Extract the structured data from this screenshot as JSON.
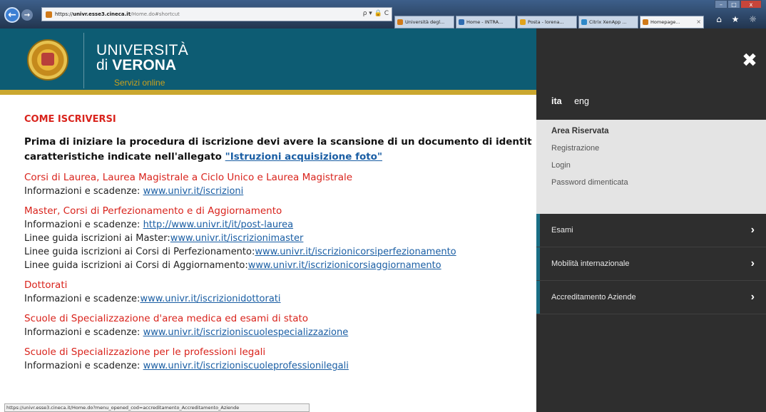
{
  "browser": {
    "url_scheme": "https://",
    "url_domain": "univr.esse3.cineca.it",
    "url_path": "/Home.do#shortcut",
    "url_display": "https://univr.esse3.cineca.it/Home.do#shortcut",
    "address_icons": "ρ ▾ 🔒 C",
    "tabs": [
      {
        "label": "Università degl...",
        "icon_color": "#d07a19",
        "active": false
      },
      {
        "label": "Home - INTRA...",
        "icon_color": "#2f6cb0",
        "active": false
      },
      {
        "label": "Posta - lorena...",
        "icon_color": "#e0a21a",
        "active": false
      },
      {
        "label": "Citrix XenApp ...",
        "icon_color": "#2e88c8",
        "active": false
      },
      {
        "label": "Homepage...",
        "icon_color": "#d07a19",
        "active": true
      }
    ],
    "tab_close": "×",
    "toolbar_icons": "⌂ ★ ☼",
    "win_min": "–",
    "win_max": "□",
    "win_close": "x",
    "status_url": "https://univr.esse3.cineca.it/Home.do?menu_opened_cod=accreditamento_Accreditamento_Aziende"
  },
  "header": {
    "uni_line1": "UNIVERSITÀ",
    "uni_line2_prefix": "di ",
    "uni_line2_bold": "VERONA",
    "servizi": "Servizi online"
  },
  "content": {
    "section_title": "COME ISCRIVERSI",
    "intro_line1": "Prima di iniziare la procedura di iscrizione devi avere la scansione di un documento di identit",
    "intro_line2_text": "caratteristiche indicate nell'allegato ",
    "intro_line2_link": "\"Istruzioni acquisizione foto\"",
    "blocks": [
      {
        "title": "Corsi di Laurea, Laurea Magistrale a Ciclo Unico e Laurea Magistrale",
        "lines": [
          {
            "text": "Informazioni e scadenze: ",
            "link": "www.univr.it/iscrizioni"
          }
        ]
      },
      {
        "title": "Master, Corsi di Perfezionamento e di Aggiornamento",
        "lines": [
          {
            "text": "Informazioni e scadenze: ",
            "link": "http://www.univr.it/it/post-laurea"
          },
          {
            "text": "Linee guida iscrizioni ai Master:",
            "link": "www.univr.it/iscrizionimaster"
          },
          {
            "text": "Linee guida iscrizioni ai Corsi di Perfezionamento:",
            "link": "www.univr.it/iscrizionicorsiperfezionamento"
          },
          {
            "text": "Linee guida iscrizioni ai Corsi di Aggiornamento:",
            "link": "www.univr.it/iscrizionicorsiaggiornamento"
          }
        ]
      },
      {
        "title": "Dottorati",
        "lines": [
          {
            "text": "Informazioni e scadenze:",
            "link": "www.univr.it/iscrizionidottorati"
          }
        ]
      },
      {
        "title": "Scuole di Specializzazione d'area medica ed esami di stato",
        "lines": [
          {
            "text": "Informazioni e scadenze: ",
            "link": "www.univr.it/iscrizioniscuolespecializzazione"
          }
        ]
      },
      {
        "title": "Scuole di Specializzazione per le professioni legali",
        "lines": [
          {
            "text": "Informazioni e scadenze: ",
            "link": "www.univr.it/iscrizioniscuoleprofessionilegali"
          }
        ]
      }
    ]
  },
  "side_panel": {
    "close_icon": "✖",
    "lang_ita": "ita",
    "lang_eng": "eng",
    "area_title": "Area Riservata",
    "area_links": [
      "Registrazione",
      "Login",
      "Password dimenticata"
    ],
    "menu": [
      {
        "label": "Esami"
      },
      {
        "label": "Mobilità internazionale"
      },
      {
        "label": "Accreditamento Aziende"
      }
    ],
    "chevron": "›"
  },
  "colors": {
    "header_teal": "#0d5c73",
    "gold": "#caa72f",
    "title_red": "#d9231c",
    "link_blue": "#1a5ea4",
    "panel_dark": "#2e2e2e",
    "panel_accent": "#1a6e84"
  }
}
